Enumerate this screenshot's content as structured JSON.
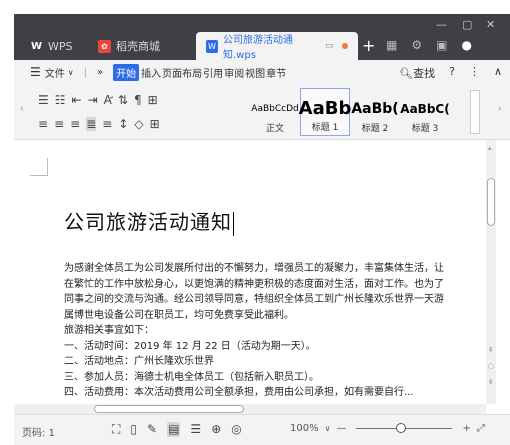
{
  "titlebar": {
    "tabs": [
      {
        "label": "WPS",
        "icon": "wps-logo-icon"
      },
      {
        "label": "稻壳商城",
        "icon": "docer-icon"
      },
      {
        "label": "公司旅游活动通知.wps",
        "icon": "writer-doc-icon"
      }
    ],
    "add_tab": "+"
  },
  "menubar": {
    "file": "文件",
    "more": "»",
    "items": [
      "开始",
      "插入",
      "页面布局",
      "引用",
      "审阅",
      "视图",
      "章节"
    ],
    "search": "查找",
    "help": "?",
    "more_options": "⋮",
    "collapse": "∧"
  },
  "ribbon": {
    "styles": [
      {
        "sample": "AaBbCcDd",
        "label": "正文"
      },
      {
        "sample": "AaBb",
        "label": "标题 1"
      },
      {
        "sample": "AaBb(",
        "label": "标题 2"
      },
      {
        "sample": "AaBbC(",
        "label": "标题 3"
      }
    ]
  },
  "document": {
    "title": "公司旅游活动通知",
    "lines": [
      "为感谢全体员工为公司发展所付出的不懈努力，增强员工的凝聚力，丰富集体生活，让",
      "在繁忙的工作中放松身心，以更饱满的精神更积极的态度面对生活，面对工作。也为了",
      "同事之间的交流与沟通。经公司领导同意，特组织全体员工到广州长隆欢乐世界一天游",
      "属博世电设备公司在职员工，均可免费享受此福利。",
      "旅游相关事宜如下：",
      "一、活动时间：2019 年 12 月 22 日（活动为期一天）。",
      "二、活动地点：广州长隆欢乐世界",
      "三、参加人员：海德士机电全体员工（包括新入职员工）。",
      "四、活动费用：本次活动费用公司全额承担，费用由公司承担，如有需要自行..."
    ]
  },
  "statusbar": {
    "page": "页码: 1",
    "zoom": "100%",
    "zoom_level": 100
  }
}
